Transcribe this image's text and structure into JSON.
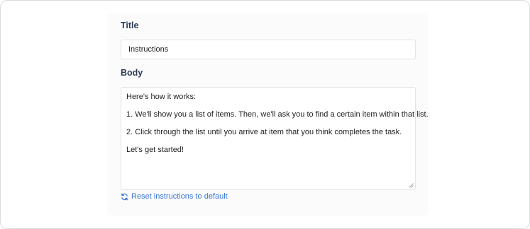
{
  "form": {
    "title_label": "Title",
    "title_value": "Instructions",
    "body_label": "Body",
    "body_paragraphs": [
      "Here's how it works:",
      "1. We'll show you a list of items. Then, we'll ask you to find a certain item within that list.",
      "2. Click through the list until you arrive at item that you think completes the task.",
      "Let's get started!"
    ],
    "reset_label": "Reset instructions to default"
  },
  "colors": {
    "label": "#2d3a54",
    "link": "#3a78d6",
    "panel_bg": "#fbfbfc",
    "border": "#e1e4e8"
  },
  "icons": {
    "reset": "refresh-icon",
    "resize": "resize-handle-icon"
  }
}
